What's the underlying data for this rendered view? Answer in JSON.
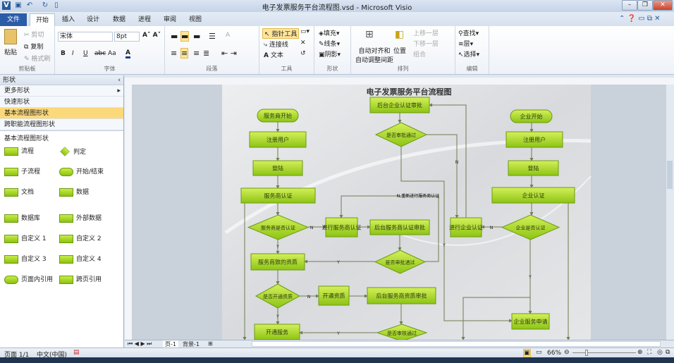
{
  "window": {
    "title": "电子发票服务平台流程图.vsd - Microsoft Visio",
    "app_icon": "V",
    "minimize": "–",
    "restore": "❐",
    "close": "✕"
  },
  "tabs": [
    {
      "label": "文件"
    },
    {
      "label": "开始"
    },
    {
      "label": "插入"
    },
    {
      "label": "设计"
    },
    {
      "label": "数据"
    },
    {
      "label": "进程"
    },
    {
      "label": "审阅"
    },
    {
      "label": "视图"
    }
  ],
  "ribbon": {
    "clipboard": {
      "label": "剪贴板",
      "paste": "粘贴",
      "cut": "剪切",
      "copy": "复制",
      "format_painter": "格式刷"
    },
    "font": {
      "label": "字体",
      "font_name": "宋体",
      "font_size": "8pt",
      "bold": "B",
      "italic": "I",
      "underline": "U",
      "strike": "abc",
      "case": "Aa",
      "color": "A"
    },
    "paragraph": {
      "label": "段落"
    },
    "tools": {
      "label": "工具",
      "pointer": "指针工具",
      "connector": "连接线",
      "text": "文本"
    },
    "shape": {
      "label": "形状",
      "fill": "填充",
      "line": "线条",
      "shadow": "阴影"
    },
    "arrange": {
      "label": "排列",
      "auto_align": "自动对齐和",
      "auto_space": "自动调整间距",
      "position": "位置",
      "bring_forward": "上移一层",
      "send_backward": "下移一层",
      "group": "组合"
    },
    "editing": {
      "label": "编辑",
      "find": "查找",
      "layers": "层",
      "select": "选择"
    }
  },
  "shapes_panel": {
    "header": "形状",
    "items": [
      {
        "label": "更多形状"
      },
      {
        "label": "快速形状"
      },
      {
        "label": "基本流程图形状",
        "selected": true
      },
      {
        "label": "跨职能流程图形状"
      }
    ],
    "stencil_title": "基本流程图形状",
    "stencil": [
      "流程",
      "判定",
      "子流程",
      "开始/结束",
      "文档",
      "数据",
      "数据库",
      "外部数据",
      "自定义 1",
      "自定义 2",
      "自定义 3",
      "自定义 4",
      "页面内引用",
      "跨页引用"
    ]
  },
  "diagram": {
    "title": "电子发票服务平台流程图",
    "nodes": [
      "服务商开始",
      "注册用户",
      "登陆",
      "服务商认证",
      "服务商是否认证",
      "进行服务商认证",
      "后台服务商认证审批",
      "是否审批通过",
      "服务商致的资质",
      "是否开通资质",
      "开通资质",
      "后台服务商资质审批",
      "开通服务",
      "是否审核通过",
      "后台企业认证审批",
      "是否审批通过",
      "企业开始",
      "注册用户",
      "登陆",
      "企业认证",
      "企业是否认证",
      "进行企业认证",
      "企业服务申请"
    ],
    "labels": {
      "n": "N",
      "y": "Y",
      "reauth": "N,重新进行服务商认证"
    },
    "colors": {
      "fill_top": "#d4f05a",
      "fill_bottom": "#8cc414",
      "stroke": "#6e9a12",
      "line": "#6f7d52"
    }
  },
  "sheetbar": {
    "page": "页-1",
    "background": "背景-1"
  },
  "status": {
    "page": "页面 1/1",
    "language": "中文(中国)",
    "zoom": "66%"
  }
}
